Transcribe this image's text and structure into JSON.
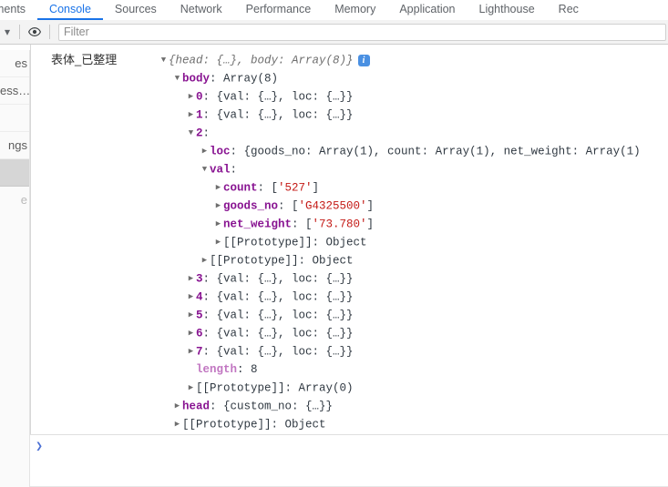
{
  "devtools": {
    "tabs": [
      {
        "label": "ments",
        "name": "tab-elements",
        "active": false,
        "clipped": true
      },
      {
        "label": "Console",
        "name": "tab-console",
        "active": true,
        "clipped": false
      },
      {
        "label": "Sources",
        "name": "tab-sources",
        "active": false,
        "clipped": false
      },
      {
        "label": "Network",
        "name": "tab-network",
        "active": false,
        "clipped": false
      },
      {
        "label": "Performance",
        "name": "tab-performance",
        "active": false,
        "clipped": false
      },
      {
        "label": "Memory",
        "name": "tab-memory",
        "active": false,
        "clipped": false
      },
      {
        "label": "Application",
        "name": "tab-application",
        "active": false,
        "clipped": false
      },
      {
        "label": "Lighthouse",
        "name": "tab-lighthouse",
        "active": false,
        "clipped": false
      },
      {
        "label": "Rec",
        "name": "tab-recorder",
        "active": false,
        "clipped": true
      }
    ],
    "toolbar": {
      "context_caret": "▾",
      "eye_icon": "eye-icon",
      "filter_placeholder": "Filter",
      "filter_value": ""
    },
    "prompt": {
      "caret": "❯",
      "value": ""
    },
    "colors": {
      "accent": "#1a73e8",
      "key": "#881391",
      "string": "#c41a16",
      "number": "#1c00cf",
      "info_badge": "#4a90e2",
      "prompt": "#4a6fd4"
    }
  },
  "app_sidebar": {
    "items": [
      {
        "label": "es",
        "name": "sidebar-item-1",
        "selected": false,
        "faded": false
      },
      {
        "label": "ess…",
        "name": "sidebar-item-2",
        "selected": false,
        "faded": false
      },
      {
        "label": "",
        "name": "sidebar-item-3",
        "selected": false,
        "faded": false
      },
      {
        "label": "ngs",
        "name": "sidebar-item-4",
        "selected": false,
        "faded": false
      },
      {
        "label": "",
        "name": "sidebar-item-5",
        "selected": true,
        "faded": false
      },
      {
        "label": "e",
        "name": "sidebar-item-6",
        "selected": false,
        "faded": true
      }
    ]
  },
  "console": {
    "origin_label": "表体_已整理",
    "info_badge": "i",
    "rows": [
      {
        "indent": 0,
        "arrow": "open",
        "name": "row-root",
        "segments": [
          {
            "cls": "obj-italic",
            "text": "{head: {…}, body: Array(8)}"
          }
        ],
        "badge": true
      },
      {
        "indent": 1,
        "arrow": "open",
        "name": "row-body",
        "segments": [
          {
            "cls": "key-name",
            "text": "body"
          },
          {
            "cls": "punct",
            "text": ": "
          },
          {
            "cls": "plain",
            "text": "Array(8)"
          }
        ]
      },
      {
        "indent": 2,
        "arrow": "closed",
        "name": "row-body-0",
        "segments": [
          {
            "cls": "key-index",
            "text": "0"
          },
          {
            "cls": "punct",
            "text": ": "
          },
          {
            "cls": "obj-preview",
            "text": "{val: {…}, loc: {…}}"
          }
        ]
      },
      {
        "indent": 2,
        "arrow": "closed",
        "name": "row-body-1",
        "segments": [
          {
            "cls": "key-index",
            "text": "1"
          },
          {
            "cls": "punct",
            "text": ": "
          },
          {
            "cls": "obj-preview",
            "text": "{val: {…}, loc: {…}}"
          }
        ]
      },
      {
        "indent": 2,
        "arrow": "open",
        "name": "row-body-2",
        "segments": [
          {
            "cls": "key-index",
            "text": "2"
          },
          {
            "cls": "punct",
            "text": ":"
          }
        ]
      },
      {
        "indent": 3,
        "arrow": "closed",
        "name": "row-body-2-loc",
        "segments": [
          {
            "cls": "key-name",
            "text": "loc"
          },
          {
            "cls": "punct",
            "text": ": "
          },
          {
            "cls": "obj-preview",
            "text": "{goods_no: Array(1), count: Array(1), net_weight: Array(1)"
          }
        ]
      },
      {
        "indent": 3,
        "arrow": "open",
        "name": "row-body-2-val",
        "segments": [
          {
            "cls": "key-name",
            "text": "val"
          },
          {
            "cls": "punct",
            "text": ":"
          }
        ]
      },
      {
        "indent": 4,
        "arrow": "closed",
        "name": "row-val-count",
        "segments": [
          {
            "cls": "key-name",
            "text": "count"
          },
          {
            "cls": "punct",
            "text": ": ["
          },
          {
            "cls": "str-val",
            "text": "'527'"
          },
          {
            "cls": "punct",
            "text": "]"
          }
        ]
      },
      {
        "indent": 4,
        "arrow": "closed",
        "name": "row-val-goods-no",
        "segments": [
          {
            "cls": "key-name",
            "text": "goods_no"
          },
          {
            "cls": "punct",
            "text": ": ["
          },
          {
            "cls": "str-val",
            "text": "'G4325500'"
          },
          {
            "cls": "punct",
            "text": "]"
          }
        ]
      },
      {
        "indent": 4,
        "arrow": "closed",
        "name": "row-val-net-weight",
        "segments": [
          {
            "cls": "key-name",
            "text": "net_weight"
          },
          {
            "cls": "punct",
            "text": ": ["
          },
          {
            "cls": "str-val",
            "text": "'73.780'"
          },
          {
            "cls": "punct",
            "text": "]"
          }
        ]
      },
      {
        "indent": 4,
        "arrow": "closed",
        "name": "row-val-prototype",
        "segments": [
          {
            "cls": "key-proto",
            "text": "[[Prototype]]: Object"
          }
        ]
      },
      {
        "indent": 3,
        "arrow": "closed",
        "name": "row-body-2-prototype",
        "segments": [
          {
            "cls": "key-proto",
            "text": "[[Prototype]]: Object"
          }
        ]
      },
      {
        "indent": 2,
        "arrow": "closed",
        "name": "row-body-3",
        "segments": [
          {
            "cls": "key-index",
            "text": "3"
          },
          {
            "cls": "punct",
            "text": ": "
          },
          {
            "cls": "obj-preview",
            "text": "{val: {…}, loc: {…}}"
          }
        ]
      },
      {
        "indent": 2,
        "arrow": "closed",
        "name": "row-body-4",
        "segments": [
          {
            "cls": "key-index",
            "text": "4"
          },
          {
            "cls": "punct",
            "text": ": "
          },
          {
            "cls": "obj-preview",
            "text": "{val: {…}, loc: {…}}"
          }
        ]
      },
      {
        "indent": 2,
        "arrow": "closed",
        "name": "row-body-5",
        "segments": [
          {
            "cls": "key-index",
            "text": "5"
          },
          {
            "cls": "punct",
            "text": ": "
          },
          {
            "cls": "obj-preview",
            "text": "{val: {…}, loc: {…}}"
          }
        ]
      },
      {
        "indent": 2,
        "arrow": "closed",
        "name": "row-body-6",
        "segments": [
          {
            "cls": "key-index",
            "text": "6"
          },
          {
            "cls": "punct",
            "text": ": "
          },
          {
            "cls": "obj-preview",
            "text": "{val: {…}, loc: {…}}"
          }
        ]
      },
      {
        "indent": 2,
        "arrow": "closed",
        "name": "row-body-7",
        "segments": [
          {
            "cls": "key-index",
            "text": "7"
          },
          {
            "cls": "punct",
            "text": ": "
          },
          {
            "cls": "obj-preview",
            "text": "{val: {…}, loc: {…}}"
          }
        ]
      },
      {
        "indent": 2,
        "arrow": "blank",
        "name": "row-body-length",
        "segments": [
          {
            "cls": "key-faded",
            "text": "length"
          },
          {
            "cls": "punct",
            "text": ": "
          },
          {
            "cls": "plain",
            "text": "8"
          }
        ]
      },
      {
        "indent": 2,
        "arrow": "closed",
        "name": "row-body-prototype",
        "segments": [
          {
            "cls": "key-proto",
            "text": "[[Prototype]]: Array(0)"
          }
        ]
      },
      {
        "indent": 1,
        "arrow": "closed",
        "name": "row-head",
        "segments": [
          {
            "cls": "key-name",
            "text": "head"
          },
          {
            "cls": "punct",
            "text": ": "
          },
          {
            "cls": "obj-preview",
            "text": "{custom_no: {…}}"
          }
        ]
      },
      {
        "indent": 1,
        "arrow": "closed",
        "name": "row-root-prototype",
        "segments": [
          {
            "cls": "key-proto",
            "text": "[[Prototype]]: Object"
          }
        ]
      }
    ]
  }
}
